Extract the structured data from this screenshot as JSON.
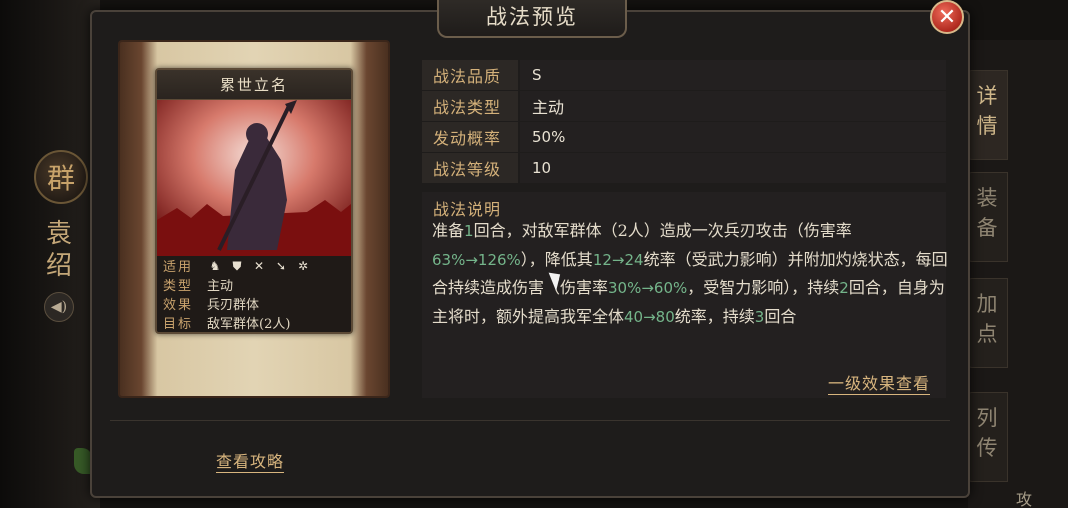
{
  "dialog": {
    "title": "战法预览",
    "close_icon": "close-icon"
  },
  "background": {
    "faction": "群",
    "hero_name": "袁绍",
    "sound_icon": "speaker-icon",
    "right_tabs": [
      "详情",
      "装备",
      "加点",
      "列传"
    ],
    "corner_label": "攻"
  },
  "card": {
    "title": "累世立名",
    "props": [
      {
        "key": "适用",
        "icons": [
          "cavalry-icon",
          "shield-icon",
          "crossed-bows-icon",
          "spear-icon",
          "wheel-icon"
        ]
      },
      {
        "key": "类型",
        "value": "主动"
      },
      {
        "key": "效果",
        "value": "兵刃群体"
      },
      {
        "key": "目标",
        "value": "敌军群体(2人)"
      }
    ]
  },
  "info": {
    "rows": [
      {
        "key": "战法品质",
        "value": "S"
      },
      {
        "key": "战法类型",
        "value": "主动"
      },
      {
        "key": "发动概率",
        "value": "50%"
      },
      {
        "key": "战法等级",
        "value": "10"
      }
    ]
  },
  "description": {
    "title": "战法说明",
    "segments": [
      "准备",
      "1",
      "回合，对敌军群体（2人）造成一次兵刃攻击（伤害率",
      "",
      "63%→126%",
      "），降低其",
      "12→24",
      "统率（受武力影响）并附加灼烧状态，每回合持续造成伤害（伤害率",
      "30%→60%",
      "，受智力影响），持续",
      "2",
      "回合，自身为主将时，额外提高我军全体",
      "40→80",
      "统率，持续",
      "3",
      "回合"
    ],
    "more_link": "一级效果查看"
  },
  "footer": {
    "guide_link": "查看攻略"
  },
  "colors": {
    "highlight": "#74b48a",
    "accent": "#d4b17a",
    "close": "#c0392b"
  }
}
